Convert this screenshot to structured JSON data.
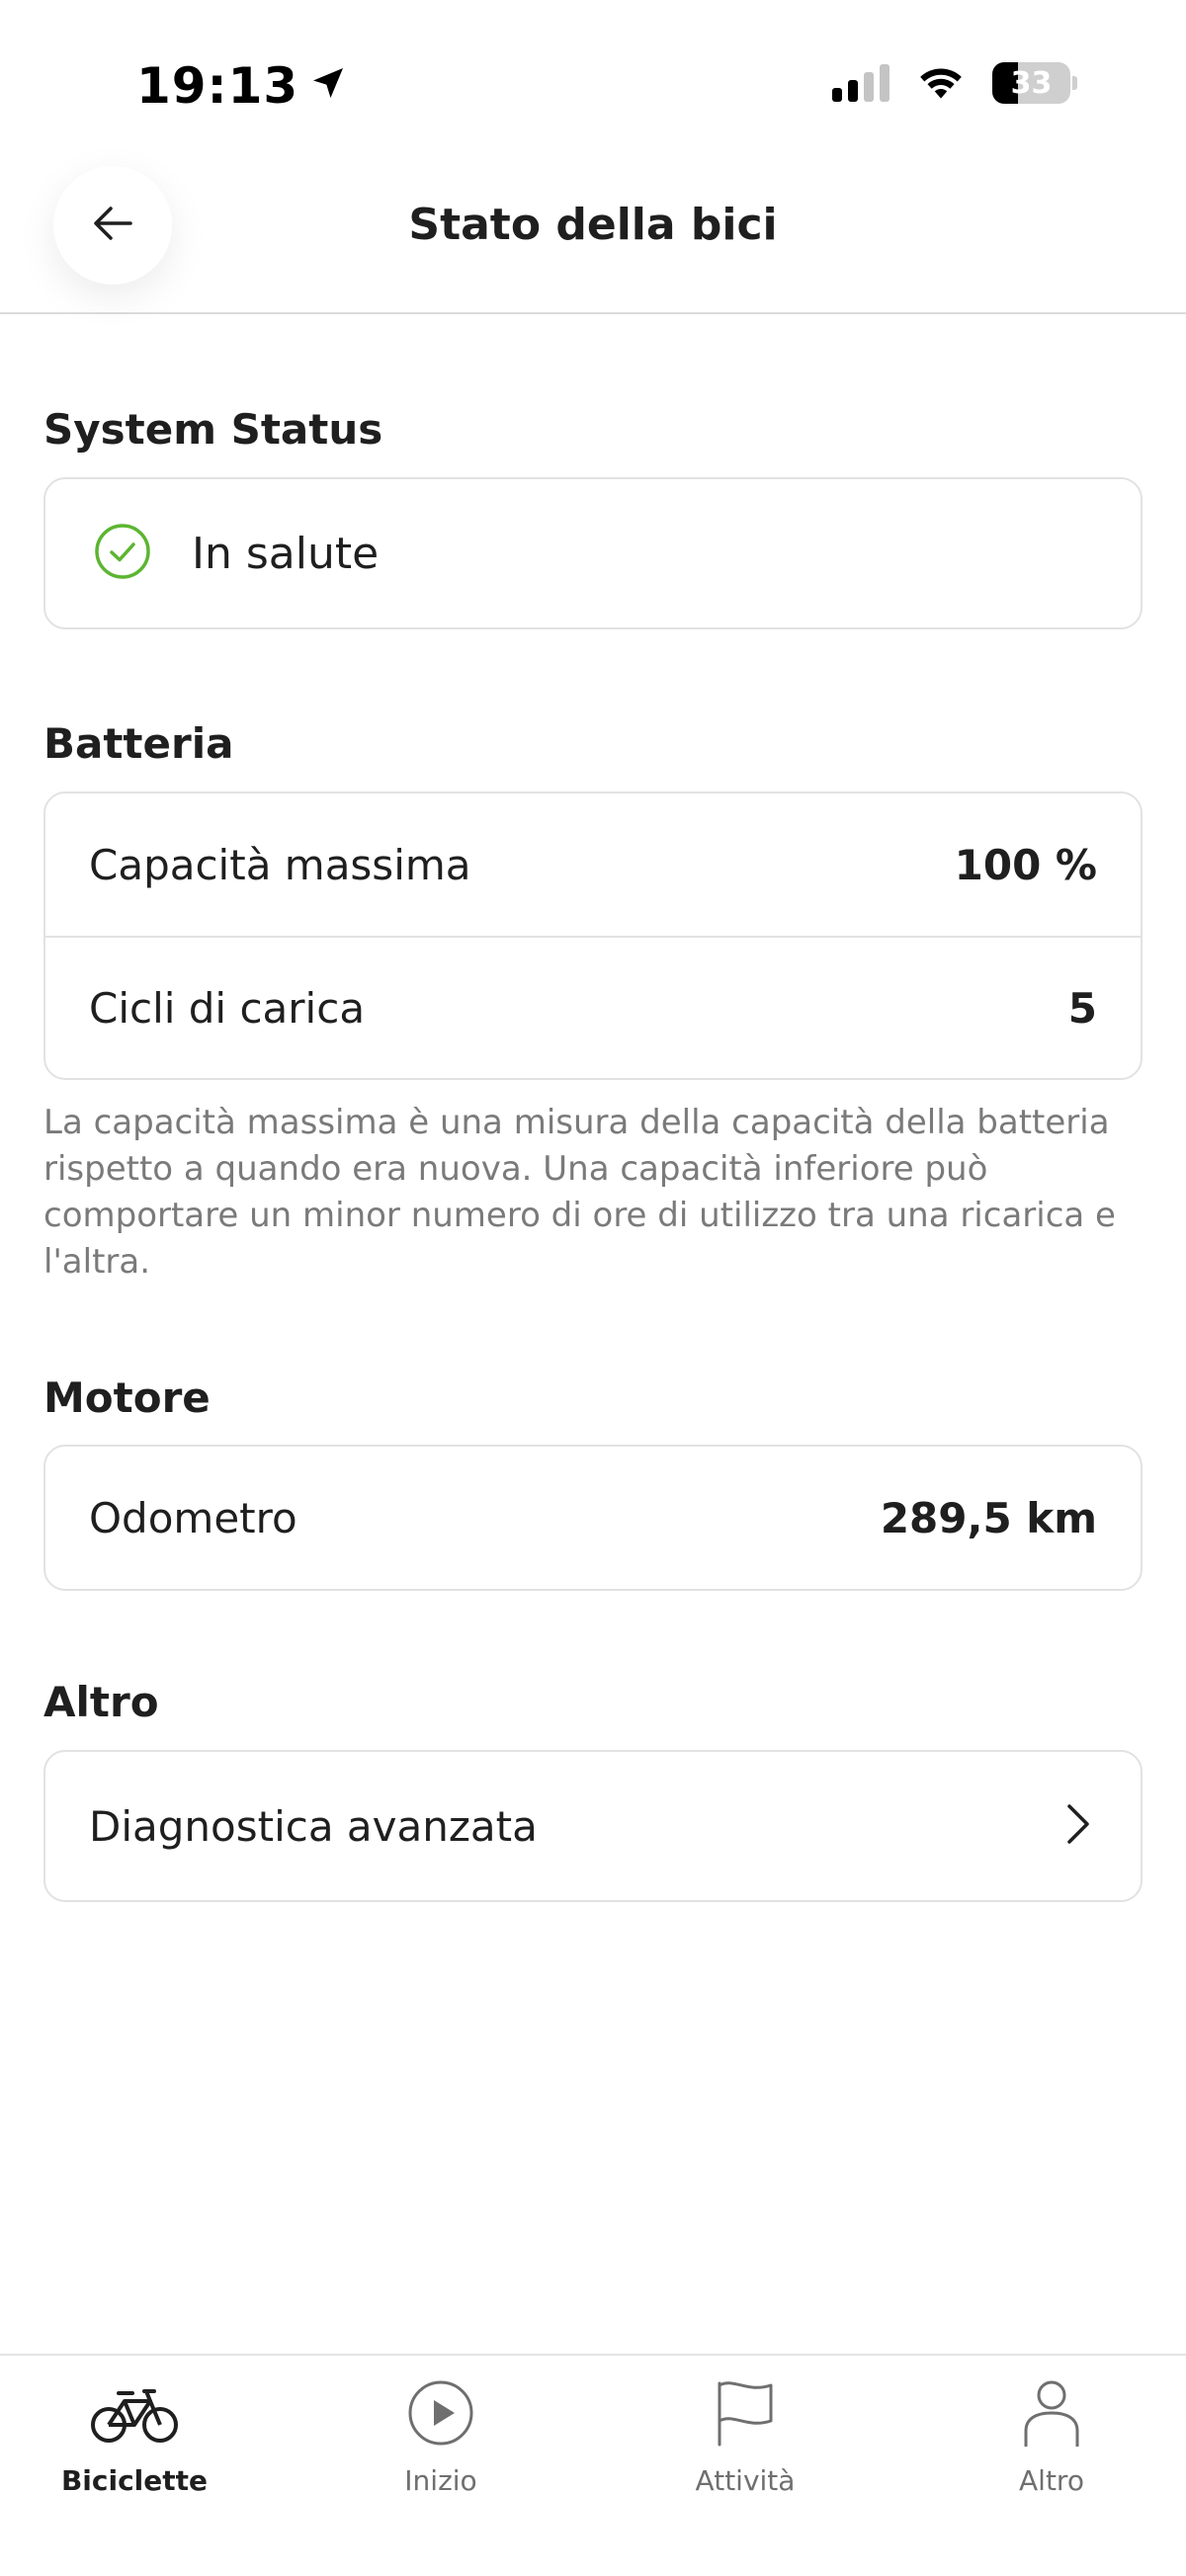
{
  "status_bar": {
    "time": "19:13",
    "battery_level": "33"
  },
  "header": {
    "title": "Stato della bici"
  },
  "system_status": {
    "title": "System Status",
    "status_label": "In salute",
    "status_color": "#5cb531"
  },
  "battery": {
    "title": "Batteria",
    "rows": [
      {
        "label": "Capacità massima",
        "value": "100 %"
      },
      {
        "label": "Cicli di carica",
        "value": "5"
      }
    ],
    "note": "La capacità massima è una misura della capacità della batteria rispetto a quando era nuova. Una capacità inferiore può comportare un minor numero di ore di utilizzo tra una ricarica e l'altra."
  },
  "motor": {
    "title": "Motore",
    "rows": [
      {
        "label": "Odometro",
        "value": "289,5 km"
      }
    ]
  },
  "other": {
    "title": "Altro",
    "rows": [
      {
        "label": "Diagnostica avanzata"
      }
    ]
  },
  "bottom_nav": {
    "items": [
      {
        "label": "Biciclette",
        "icon": "bicycle-icon",
        "active": true
      },
      {
        "label": "Inizio",
        "icon": "play-icon",
        "active": false
      },
      {
        "label": "Attività",
        "icon": "flag-icon",
        "active": false
      },
      {
        "label": "Altro",
        "icon": "person-icon",
        "active": false
      }
    ]
  }
}
